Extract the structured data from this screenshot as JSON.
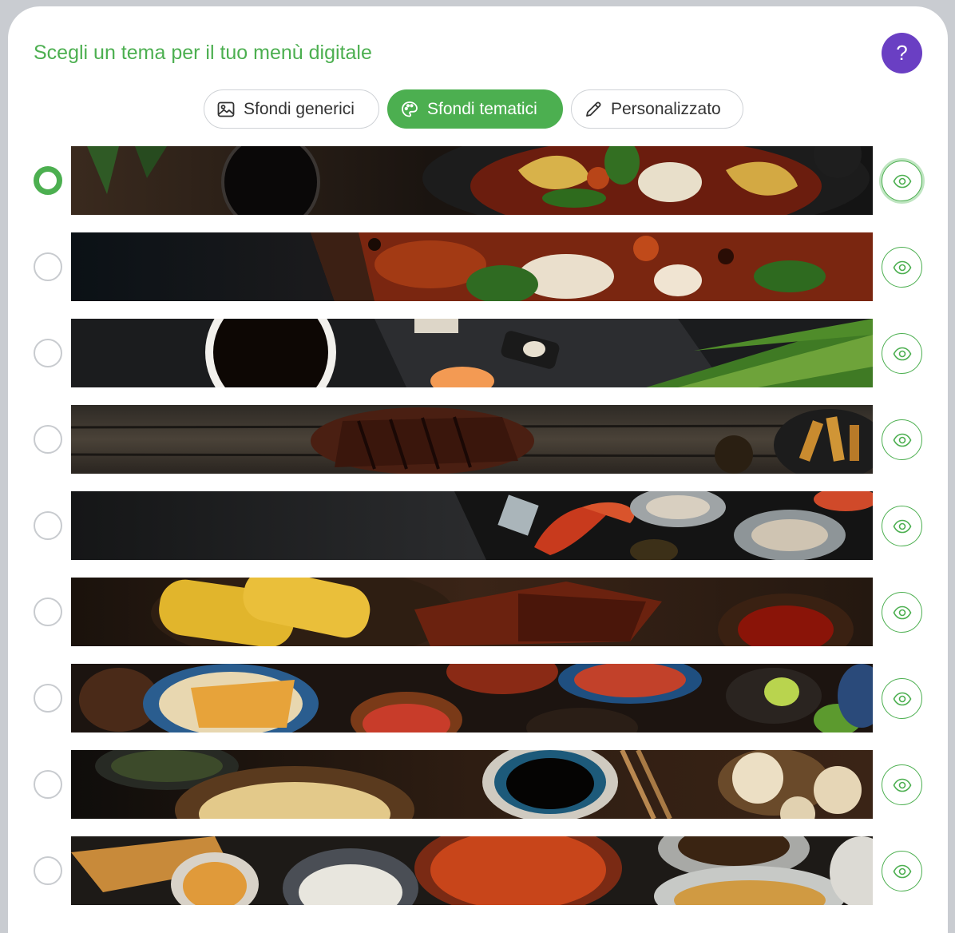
{
  "header": {
    "title": "Scegli un tema per il tuo menù digitale",
    "help_label": "?"
  },
  "tabs": [
    {
      "label": "Sfondi generici",
      "icon": "image-icon",
      "active": false
    },
    {
      "label": "Sfondi tematici",
      "icon": "palette-icon",
      "active": true
    },
    {
      "label": "Personalizzato",
      "icon": "pencil-icon",
      "active": false
    }
  ],
  "themes": [
    {
      "name": "pasta-italiana",
      "selected": true
    },
    {
      "name": "pizza",
      "selected": false
    },
    {
      "name": "sushi",
      "selected": false
    },
    {
      "name": "steakhouse",
      "selected": false
    },
    {
      "name": "frutti-di-mare",
      "selected": false
    },
    {
      "name": "barbecue",
      "selected": false
    },
    {
      "name": "messicano",
      "selected": false
    },
    {
      "name": "cinese",
      "selected": false
    },
    {
      "name": "indiano",
      "selected": false
    }
  ],
  "colors": {
    "accent": "#4caf50",
    "help": "#6a3fc3"
  }
}
